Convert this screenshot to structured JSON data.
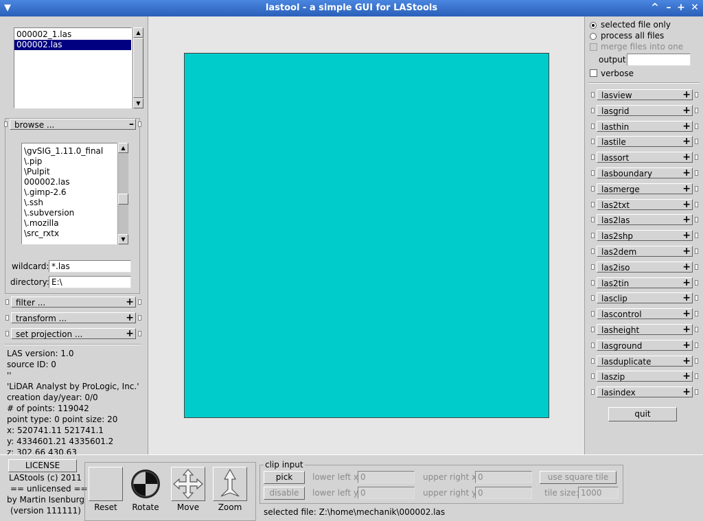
{
  "window": {
    "title": "lastool - a simple GUI for LAStools",
    "buttons": [
      "^",
      "–",
      "+",
      "✕"
    ]
  },
  "file_list": {
    "items": [
      "000002_1.las",
      "000002.las"
    ],
    "selected_index": 1
  },
  "browse": {
    "label": "browse ...",
    "toggle": "–",
    "items": [
      "\\gvSIG_1.11.0_final",
      "\\.pip",
      "\\Pulpit",
      "000002.las",
      "\\.gimp-2.6",
      "\\.ssh",
      "\\.subversion",
      "\\.mozilla",
      "\\src_rxtx"
    ],
    "wildcard_label": "wildcard:",
    "wildcard_value": "*.las",
    "directory_label": "directory:",
    "directory_value": "E:\\"
  },
  "left_sections": [
    {
      "label": "filter ...",
      "toggle": "+"
    },
    {
      "label": "transform ...",
      "toggle": "+"
    },
    {
      "label": "set projection ...",
      "toggle": "+"
    }
  ],
  "info": [
    "LAS version: 1.0",
    "source ID: 0",
    "''",
    "'LiDAR Analyst by ProLogic, Inc.'",
    "creation day/year: 0/0",
    "# of points: 119042",
    "point type: 0 point size: 20",
    "x: 520741.11 521741.1",
    "y: 4334601.21 4335601.2",
    "z: 302.66 430.63"
  ],
  "license": {
    "button": "LICENSE",
    "lines": [
      "LAStools (c) 2011",
      "== unlicensed ==",
      "by Martin Isenburg",
      "(version 111111)"
    ]
  },
  "tools": [
    {
      "label": "Reset",
      "icon": "blank-icon"
    },
    {
      "label": "Rotate",
      "icon": "rotate-ball-icon"
    },
    {
      "label": "Move",
      "icon": "move-arrows-icon"
    },
    {
      "label": "Zoom",
      "icon": "zoom-arrow-icon"
    }
  ],
  "clip": {
    "title": "clip input",
    "pick": "pick",
    "disable": "disable",
    "lower_left_x_label": "lower left x:",
    "lower_left_x": "0",
    "lower_left_y_label": "lower left y:",
    "lower_left_y": "0",
    "upper_right_x_label": "upper right x:",
    "upper_right_x": "0",
    "upper_right_y_label": "upper right y:",
    "upper_right_y": "0",
    "square_tile": "use square tile",
    "tile_size_label": "tile size:",
    "tile_size": "1000"
  },
  "status": {
    "selected_file": "selected file: Z:\\home\\mechanik\\000002.las"
  },
  "options": {
    "selected_only": "selected file only",
    "process_all": "process all files",
    "merge": "merge files into one",
    "output_label": "output:",
    "output_value": "",
    "verbose": "verbose"
  },
  "tool_sections": [
    "lasview",
    "lasgrid",
    "lasthin",
    "lastile",
    "lassort",
    "lasboundary",
    "lasmerge",
    "las2txt",
    "las2las",
    "las2shp",
    "las2dem",
    "las2iso",
    "las2tin",
    "lasclip",
    "lascontrol",
    "lasheight",
    "lasground",
    "lasduplicate",
    "laszip",
    "lasindex"
  ],
  "tool_toggle": "+",
  "quit": "quit",
  "colors": {
    "viewport": "#00cccc",
    "canvas_bg": "#e6e6e6",
    "titlebar": "#3b73cc"
  }
}
